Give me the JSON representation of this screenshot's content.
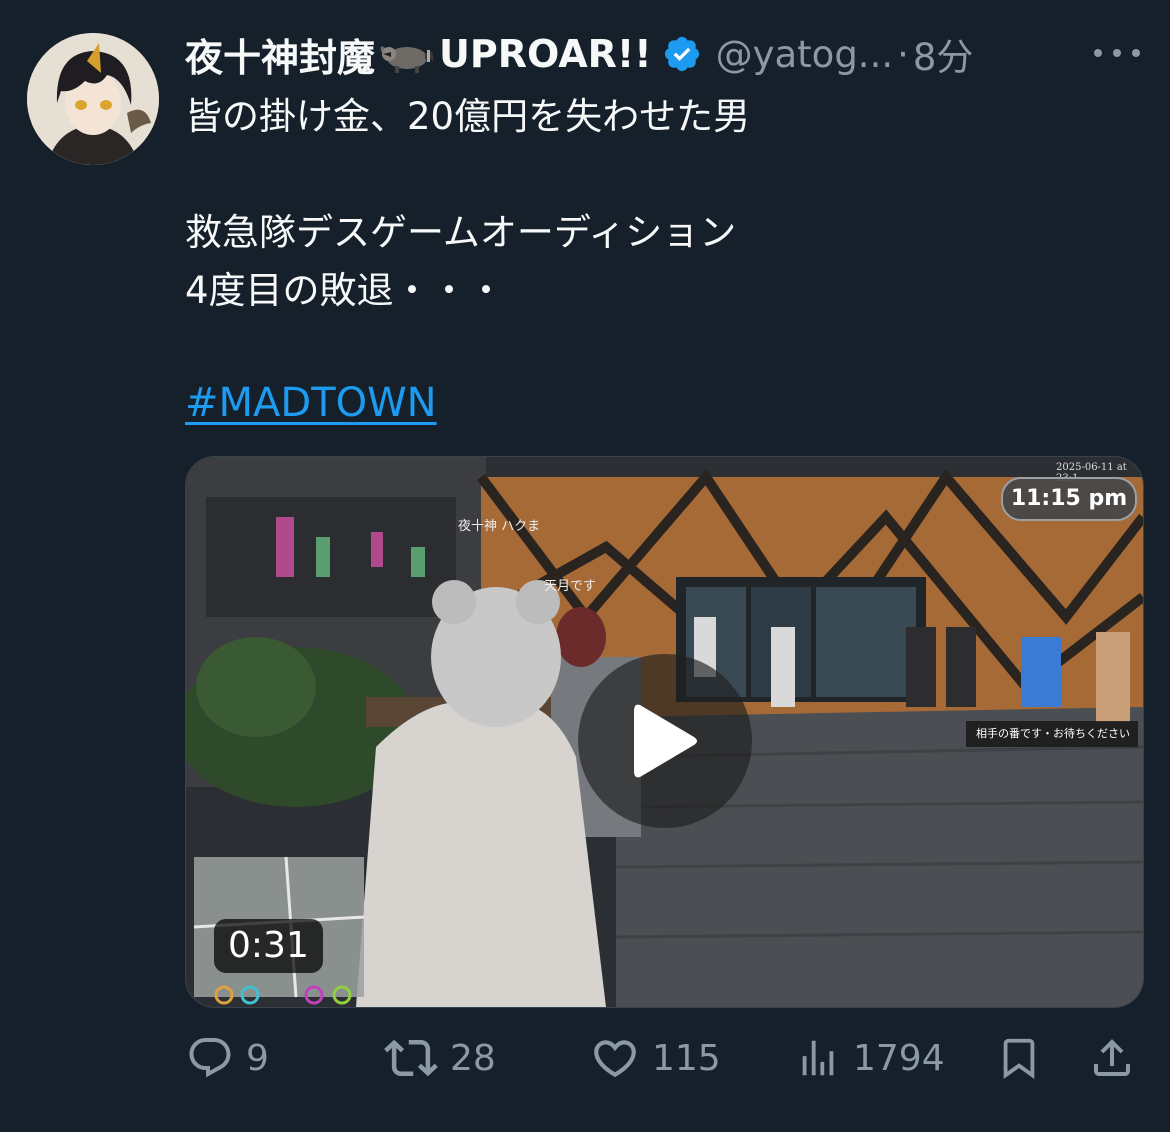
{
  "author": {
    "display_name": "夜十神封魔",
    "display_name_suffix": "UPROAR!!",
    "emoji": "raccoon-emoji",
    "handle": "@yatog...",
    "separator": "·",
    "time": "8分"
  },
  "tweet": {
    "lines": [
      "皆の掛け金、20億円を失わせた男",
      "救急隊デスゲームオーディション",
      "4度目の敗退・・・"
    ],
    "hashtag": "#MADTOWN"
  },
  "media": {
    "duration": "0:31",
    "clock": "11:15 pm",
    "stamp": "2025-06-11 at 23:1",
    "overlay_name_1": "夜十神 ハクま",
    "overlay_name_2": "天月です",
    "toast": "相手の番です・お待ちください"
  },
  "actions": {
    "replies": "9",
    "reposts": "28",
    "likes": "115",
    "views": "1794"
  },
  "colors": {
    "background": "#15202b",
    "text": "#f7f9f9",
    "secondary": "#8b98a5",
    "accent": "#1d9bf0"
  }
}
